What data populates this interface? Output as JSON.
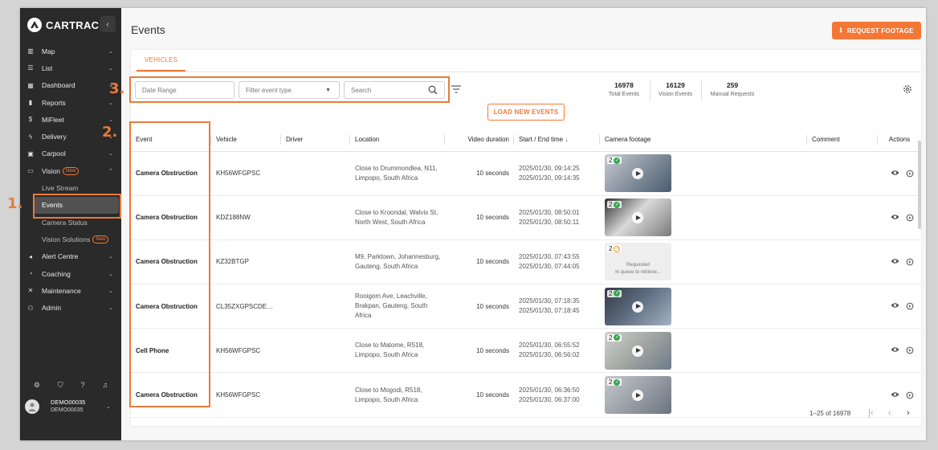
{
  "brand": {
    "name": "CARTRACK"
  },
  "colors": {
    "accent": "#f47735",
    "sidebar_bg": "#2a2a2a",
    "annotation": "#e87b3a",
    "success": "#3aa655"
  },
  "sidebar": {
    "items": [
      {
        "label": "Map",
        "icon": "map-icon",
        "chevron": "⌄"
      },
      {
        "label": "List",
        "icon": "list-icon",
        "chevron": "⌄"
      },
      {
        "label": "Dashboard",
        "icon": "dashboard-icon",
        "chevron": "⌄"
      },
      {
        "label": "Reports",
        "icon": "reports-icon",
        "chevron": "⌄"
      },
      {
        "label": "MiFleet",
        "icon": "dollar-icon",
        "chevron": "⌄"
      },
      {
        "label": "Delivery",
        "icon": "bolt-icon",
        "chevron": "⌄"
      },
      {
        "label": "Carpool",
        "icon": "calendar-icon",
        "chevron": "⌄"
      },
      {
        "label": "Vision",
        "icon": "camera-icon",
        "chevron": "⌃",
        "badge": "New"
      },
      {
        "label": "Live Stream"
      },
      {
        "label": "Events"
      },
      {
        "label": "Camera Status"
      },
      {
        "label": "Vision Solutions",
        "badge": "New"
      },
      {
        "label": "Alert Centre",
        "icon": "alert-icon",
        "chevron": "⌄"
      },
      {
        "label": "Coaching",
        "icon": "coaching-icon",
        "chevron": "⌄"
      },
      {
        "label": "Maintenance",
        "icon": "tools-icon",
        "chevron": "⌄"
      },
      {
        "label": "Admin",
        "icon": "admin-icon",
        "chevron": "⌄"
      }
    ],
    "user": {
      "name": "DEMO00035",
      "account": "DEMO00035"
    }
  },
  "header": {
    "title": "Events",
    "request_button": "REQUEST FOOTAGE"
  },
  "tabs": [
    {
      "label": "VEHICLES"
    }
  ],
  "filters": {
    "date_range_placeholder": "Date Range",
    "event_type_placeholder": "Filter event type",
    "search_placeholder": "Search"
  },
  "stats": [
    {
      "value": "16978",
      "label": "Total Events"
    },
    {
      "value": "16129",
      "label": "Vision Events"
    },
    {
      "value": "259",
      "label": "Manual Requests"
    }
  ],
  "load_button": "LOAD NEW EVENTS",
  "table": {
    "columns": [
      "Event",
      "Vehicle",
      "Driver",
      "Location",
      "Video duration",
      "Start / End time",
      "Camera footage",
      "Comment",
      "Actions"
    ],
    "rows": [
      {
        "event": "Camera Obstruction",
        "vehicle": "KH56WFGPSC",
        "driver": "",
        "location": "Close to Drummondlea, N11, Limpopo, South Africa",
        "duration": "10 seconds",
        "start": "2025/01/30, 09:14:25",
        "end": "2025/01/30, 09:14:35",
        "footage_count": "2",
        "footage_status": "ready"
      },
      {
        "event": "Camera Obstruction",
        "vehicle": "KDZ188NW",
        "driver": "",
        "location": "Close to Kroondal, Walvis St, North West, South Africa",
        "duration": "10 seconds",
        "start": "2025/01/30, 08:50:01",
        "end": "2025/01/30, 08:50:11",
        "footage_count": "2",
        "footage_status": "ready"
      },
      {
        "event": "Camera Obstruction",
        "vehicle": "KZ32BTGP",
        "driver": "",
        "location": "M9, Parktown, Johannesburg, Gauteng, South Africa",
        "duration": "10 seconds",
        "start": "2025/01/30, 07:43:55",
        "end": "2025/01/30, 07:44:05",
        "footage_count": "2",
        "footage_status": "requested",
        "footage_text_1": "Requested",
        "footage_text_2": "In queue to retrieve..."
      },
      {
        "event": "Camera Obstruction",
        "vehicle": "CL35ZXGPSCDE…",
        "driver": "",
        "location": "Rooigom Ave, Leachville, Brakpan, Gauteng, South Africa",
        "duration": "10 seconds",
        "start": "2025/01/30, 07:18:35",
        "end": "2025/01/30, 07:18:45",
        "footage_count": "2",
        "footage_status": "ready"
      },
      {
        "event": "Cell Phone",
        "vehicle": "KH56WFGPSC",
        "driver": "",
        "location": "Close to Matome, R518, Limpopo, South Africa",
        "duration": "10 seconds",
        "start": "2025/01/30, 06:55:52",
        "end": "2025/01/30, 06:56:02",
        "footage_count": "2",
        "footage_status": "ready"
      },
      {
        "event": "Camera Obstruction",
        "vehicle": "KH56WFGPSC",
        "driver": "",
        "location": "Close to Mogodi, R518, Limpopo, South Africa",
        "duration": "10 seconds",
        "start": "2025/01/30, 06:36:50",
        "end": "2025/01/30, 06:37:00",
        "footage_count": "2",
        "footage_status": "ready"
      }
    ]
  },
  "pagination": {
    "range": "1–25 of 16978"
  },
  "annotations": {
    "a1": "1.",
    "a2": "2.",
    "a3": "3."
  }
}
